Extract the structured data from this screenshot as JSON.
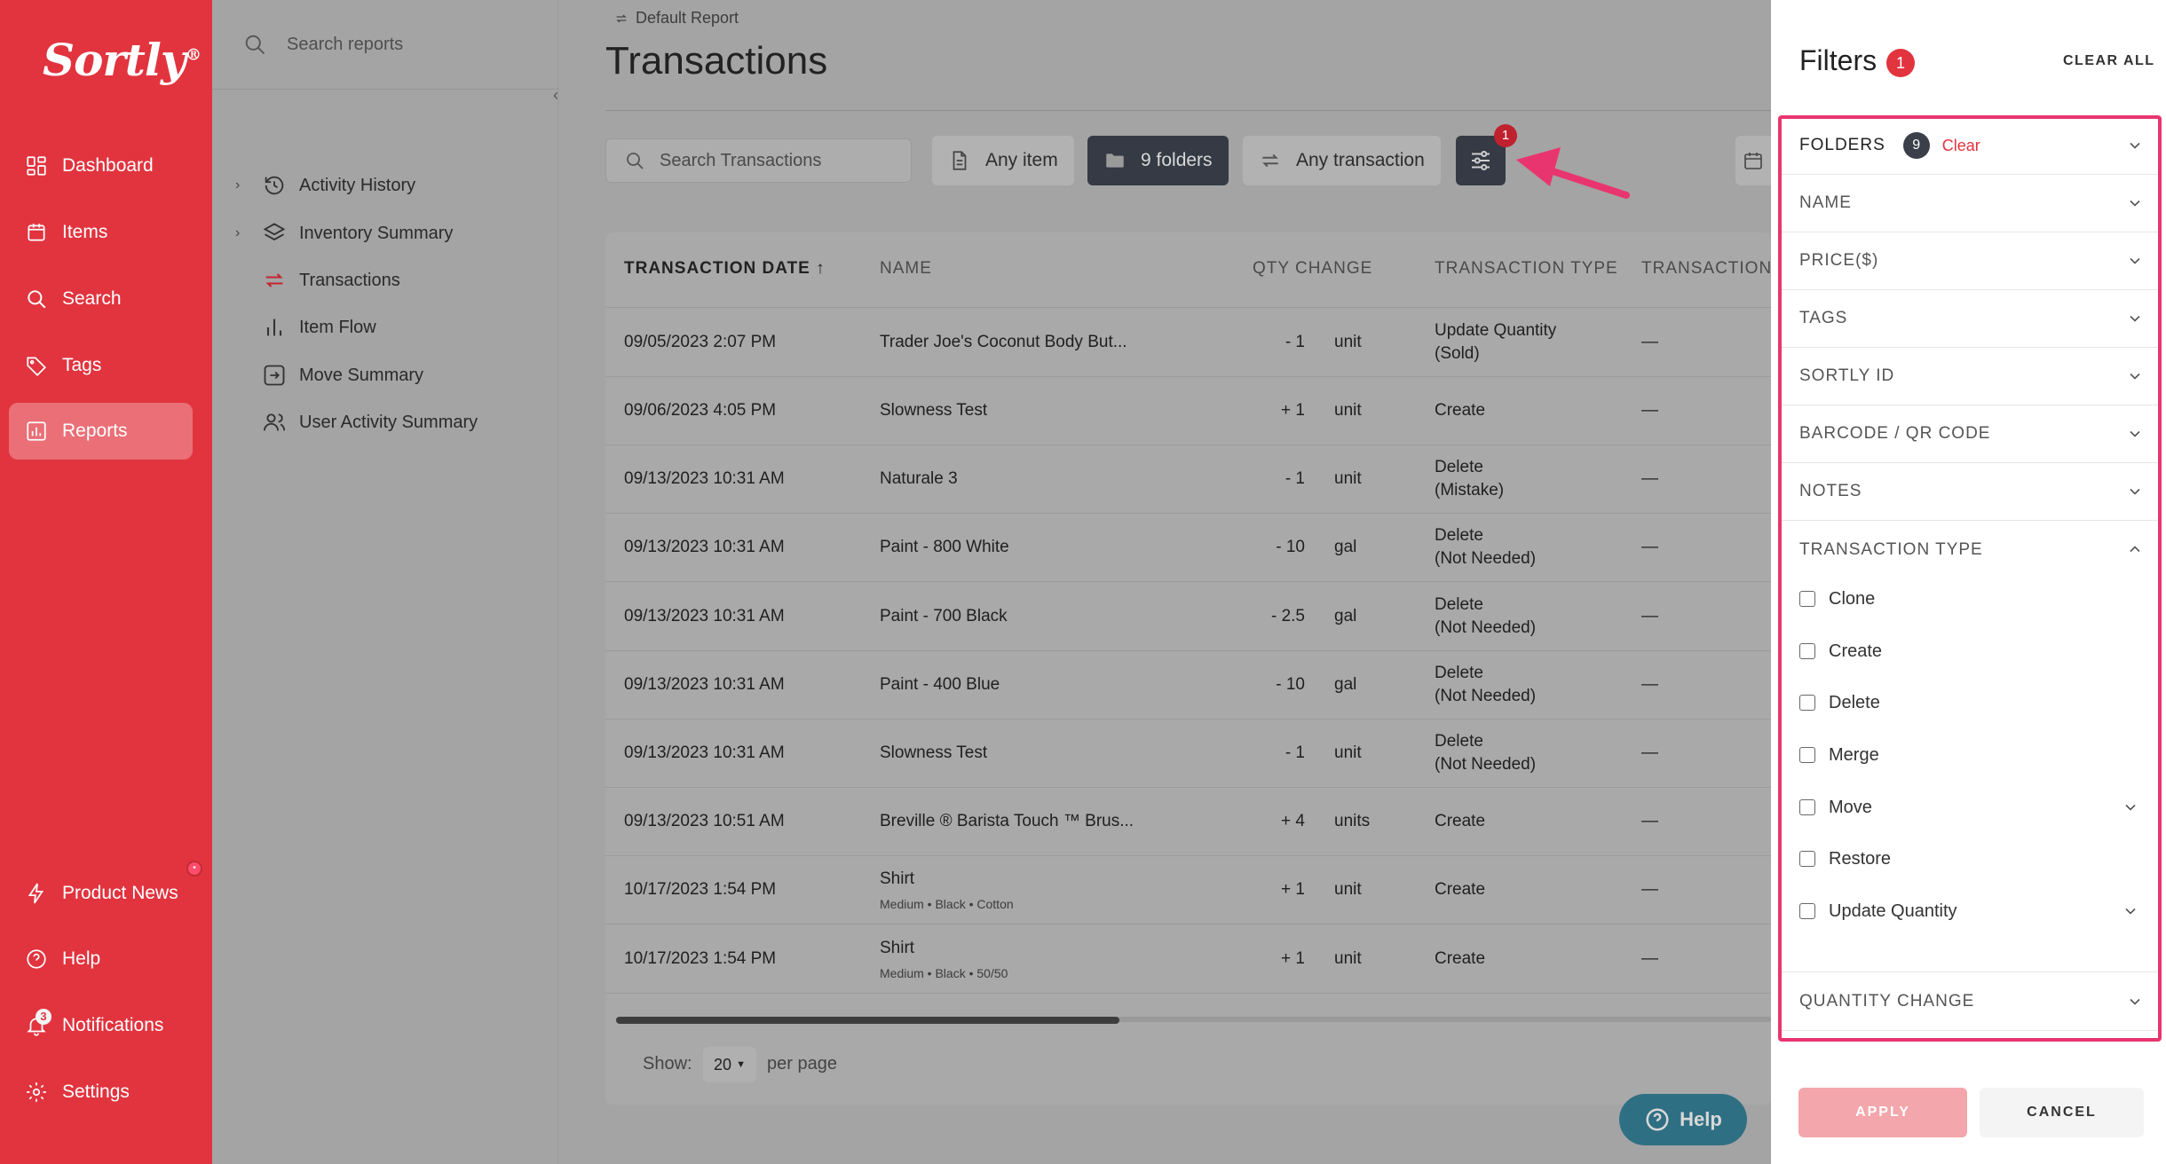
{
  "nav": {
    "logo": "Sortly",
    "logo_mark": "®",
    "items": [
      {
        "label": "Dashboard",
        "icon": "dashboard-icon"
      },
      {
        "label": "Items",
        "icon": "items-icon"
      },
      {
        "label": "Search",
        "icon": "search-icon"
      },
      {
        "label": "Tags",
        "icon": "tag-icon"
      },
      {
        "label": "Reports",
        "icon": "reports-icon",
        "active": true
      }
    ],
    "bottom_items": [
      {
        "label": "Product News",
        "icon": "lightning-icon"
      },
      {
        "label": "Help",
        "icon": "help-icon"
      },
      {
        "label": "Notifications",
        "icon": "bell-icon",
        "badge": "3"
      },
      {
        "label": "Settings",
        "icon": "gear-icon"
      }
    ]
  },
  "reports_panel": {
    "search_placeholder": "Search reports",
    "collapse": "‹",
    "items": [
      {
        "label": "Activity History",
        "icon": "history-icon",
        "expandable": true
      },
      {
        "label": "Inventory Summary",
        "icon": "layers-icon",
        "expandable": true
      },
      {
        "label": "Transactions",
        "icon": "transactions-icon",
        "active": true
      },
      {
        "label": "Item Flow",
        "icon": "bar-chart-icon"
      },
      {
        "label": "Move Summary",
        "icon": "move-icon"
      },
      {
        "label": "User Activity Summary",
        "icon": "users-icon"
      }
    ]
  },
  "main": {
    "breadcrumb": "Default Report",
    "title": "Transactions",
    "toolbar": {
      "search_placeholder": "Search Transactions",
      "any_item": "Any item",
      "folders": "9 folders",
      "any_transaction": "Any transaction",
      "filter_badge": "1"
    },
    "table": {
      "columns": [
        "TRANSACTION DATE",
        "NAME",
        "QTY CHANGE",
        "TRANSACTION TYPE",
        "TRANSACTION I"
      ],
      "sort_arrow": "↑",
      "rows": [
        {
          "date": "09/05/2023 2:07 PM",
          "name": "Trader Joe's Coconut Body But...",
          "sub": "",
          "qty": "- 1",
          "unit": "unit",
          "type1": "Update Quantity",
          "type2": "(Sold)",
          "tid": "—"
        },
        {
          "date": "09/06/2023 4:05 PM",
          "name": "Slowness Test",
          "sub": "",
          "qty": "+ 1",
          "unit": "unit",
          "type1": "Create",
          "type2": "",
          "tid": "—"
        },
        {
          "date": "09/13/2023 10:31 AM",
          "name": "Naturale 3",
          "sub": "",
          "qty": "- 1",
          "unit": "unit",
          "type1": "Delete",
          "type2": "(Mistake)",
          "tid": "—"
        },
        {
          "date": "09/13/2023 10:31 AM",
          "name": "Paint - 800 White",
          "sub": "",
          "qty": "- 10",
          "unit": "gal",
          "type1": "Delete",
          "type2": "(Not Needed)",
          "tid": "—"
        },
        {
          "date": "09/13/2023 10:31 AM",
          "name": "Paint - 700 Black",
          "sub": "",
          "qty": "- 2.5",
          "unit": "gal",
          "type1": "Delete",
          "type2": "(Not Needed)",
          "tid": "—"
        },
        {
          "date": "09/13/2023 10:31 AM",
          "name": "Paint - 400 Blue",
          "sub": "",
          "qty": "- 10",
          "unit": "gal",
          "type1": "Delete",
          "type2": "(Not Needed)",
          "tid": "—"
        },
        {
          "date": "09/13/2023 10:31 AM",
          "name": "Slowness Test",
          "sub": "",
          "qty": "- 1",
          "unit": "unit",
          "type1": "Delete",
          "type2": "(Not Needed)",
          "tid": "—"
        },
        {
          "date": "09/13/2023 10:51 AM",
          "name": "Breville ® Barista Touch ™ Brus...",
          "sub": "",
          "qty": "+ 4",
          "unit": "units",
          "type1": "Create",
          "type2": "",
          "tid": "—"
        },
        {
          "date": "10/17/2023 1:54 PM",
          "name": "Shirt",
          "sub": "Medium • Black • Cotton",
          "qty": "+ 1",
          "unit": "unit",
          "type1": "Create",
          "type2": "",
          "tid": "—"
        },
        {
          "date": "10/17/2023 1:54 PM",
          "name": "Shirt",
          "sub": "Medium • Black • 50/50",
          "qty": "+ 1",
          "unit": "unit",
          "type1": "Create",
          "type2": "",
          "tid": "—"
        }
      ]
    },
    "pagination": {
      "show_label": "Show:",
      "page_size": "20",
      "per_page": "per page"
    },
    "help_button": "Help"
  },
  "drawer": {
    "title": "Filters",
    "badge": "1",
    "clear_all": "CLEAR ALL",
    "sections": [
      "FOLDERS",
      "NAME",
      "PRICE($)",
      "TAGS",
      "SORTLY ID",
      "BARCODE / QR CODE",
      "NOTES",
      "TRANSACTION TYPE",
      "QUANTITY CHANGE"
    ],
    "folders_count": "9",
    "folders_clear": "Clear",
    "transaction_types": [
      {
        "label": "Clone",
        "expandable": false
      },
      {
        "label": "Create",
        "expandable": false
      },
      {
        "label": "Delete",
        "expandable": false
      },
      {
        "label": "Merge",
        "expandable": false
      },
      {
        "label": "Move",
        "expandable": true
      },
      {
        "label": "Restore",
        "expandable": false
      },
      {
        "label": "Update Quantity",
        "expandable": true
      }
    ],
    "apply": "APPLY",
    "cancel": "CANCEL"
  },
  "colors": {
    "brand": "#e1343f",
    "highlight": "#e9356f",
    "dark_button": "#353a44"
  }
}
